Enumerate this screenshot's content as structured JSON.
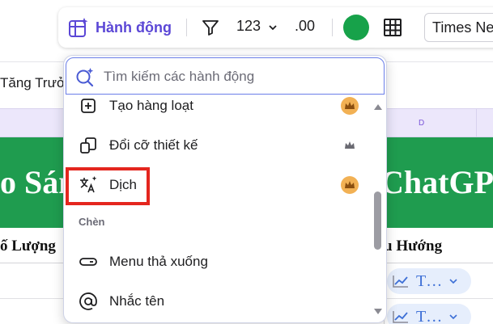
{
  "toolbar": {
    "actions_label": "Hành động",
    "number_format": "123",
    "decimal_format": ".00",
    "fill_color": "#17a24a",
    "font_family": "Times New Roman"
  },
  "sheet": {
    "file_title": "Tăng Trưở",
    "column_d": "D",
    "banner_left": "o Sán",
    "banner_right": "ChatGP",
    "header_left": "ố Lượng",
    "header_right": "u Hướng",
    "trend_pill_text": "T…",
    "accent_color": "#1f9c4f"
  },
  "menu": {
    "search_placeholder": "Tìm kiếm các hành động",
    "items": [
      {
        "label": "Tạo hàng loạt",
        "icon": "bulk-create-icon",
        "pro": true
      },
      {
        "label": "Đổi cỡ thiết kế",
        "icon": "resize-icon",
        "pro": false
      },
      {
        "label": "Dịch",
        "icon": "translate-icon",
        "pro": true
      }
    ],
    "section_insert": "Chèn",
    "insert_items": [
      {
        "label": "Menu thả xuống",
        "icon": "dropdown-menu-icon"
      },
      {
        "label": "Nhắc tên",
        "icon": "mention-icon"
      }
    ],
    "highlight_color": "#e4261e"
  }
}
